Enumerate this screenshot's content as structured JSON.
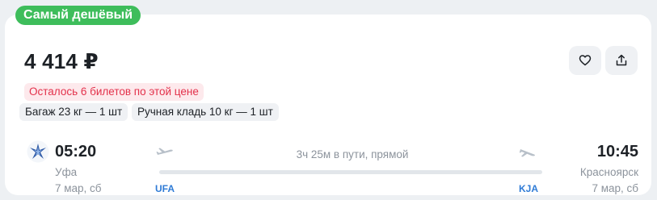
{
  "badge": "Самый дешёвый",
  "price": "4 414 ₽",
  "actions": {
    "favorite_icon": "heart-icon",
    "share_icon": "share-icon"
  },
  "warning": "Осталось 6 билетов по этой цене",
  "chips": [
    "Багаж 23 кг — 1 шт",
    "Ручная кладь 10 кг — 1 шт"
  ],
  "flight": {
    "airline_logo": "airline-logo",
    "departure": {
      "time": "05:20",
      "city": "Уфа",
      "date": "7 мар, сб",
      "code": "UFA"
    },
    "arrival": {
      "time": "10:45",
      "city": "Красноярск",
      "date": "7 мар, сб",
      "code": "KJA"
    },
    "duration": "3ч 25м в пути, прямой"
  },
  "colors": {
    "badge_bg": "#3ebd5b",
    "warning_text": "#e3314b",
    "warning_bg": "#fde9ec",
    "airport_code": "#2f7bd6"
  }
}
